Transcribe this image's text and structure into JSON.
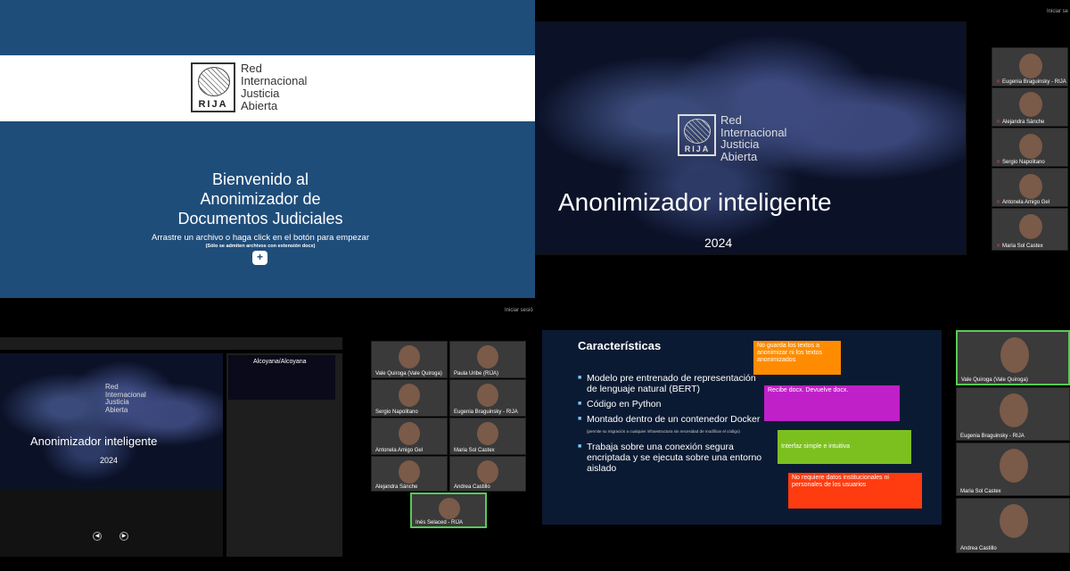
{
  "top_left": {
    "logo_lines": [
      "Red",
      "Internacional",
      "Justicia",
      "Abierta"
    ],
    "logo_mark": "RIJA",
    "welcome": [
      "Bienvenido al",
      "Anonimizador de",
      "Documentos Judiciales"
    ],
    "drag_text": "Arrastre un archivo o haga click en el botón para empezar",
    "note": "(Sólo se admiten archivos con extensión docx)",
    "plus": "+"
  },
  "top_right": {
    "top_label": "Iniciar se",
    "slide_logo_lines": [
      "Red",
      "Internacional",
      "Justicia",
      "Abierta"
    ],
    "slide_logo_mark": "RIJA",
    "slide_title": "Anonimizador inteligente",
    "slide_year": "2024",
    "participants": [
      "Eugenia Braguinsky - RIJA",
      "Alejandra Sánche",
      "Sergio Napolitano",
      "Antonela Amigo Gel",
      "Maria Sol Castex"
    ]
  },
  "bottom_left": {
    "top_label": "Iniciar sesió",
    "slide_title": "Anonimizador inteligente",
    "slide_year": "2024",
    "logo_lines": [
      "Red",
      "Internacional",
      "Justicia",
      "Abierta"
    ],
    "next_slide_label": "Alcoyana/Alcoyana",
    "participants": [
      "Vale Quiroga (Vale Quiroga)",
      "Paula Uribe (RIJA)",
      "Sergio Napolitano",
      "Eugenia Braguinsky - RIJA",
      "Antonela Amigo Gel",
      "Maria Sol Castex",
      "Alejandra Sánche",
      "Andrea Castillo",
      "Inés Selaced - RIJA"
    ]
  },
  "bottom_right": {
    "heading": "Características",
    "bullets": [
      {
        "text": "Modelo pre entrenado de representación de lenguaje natural (BERT)",
        "fine": ""
      },
      {
        "text": "Código en Python",
        "fine": ""
      },
      {
        "text": "Montado dentro de un contenedor Docker",
        "fine": "(permite su migración a cualquier infraestructura sin necesidad de modificar el código)"
      },
      {
        "text": "Trabaja sobre una conexión segura encriptada y se ejecuta sobre una entorno aislado",
        "fine": ""
      }
    ],
    "boxes": [
      "No guarda los textos a anonimizar ni los textos anonimizados",
      "Recibe docx. Devuelve docx.",
      "Interfaz simple e intuitiva",
      "No requiere datos institucionales ni personales de los usuarios"
    ],
    "participants": [
      "Vale Quiroga (Vale Quiroga)",
      "Eugenia Braguinsky - RIJA",
      "Maria Sol Castex",
      "Andrea Castillo"
    ]
  }
}
